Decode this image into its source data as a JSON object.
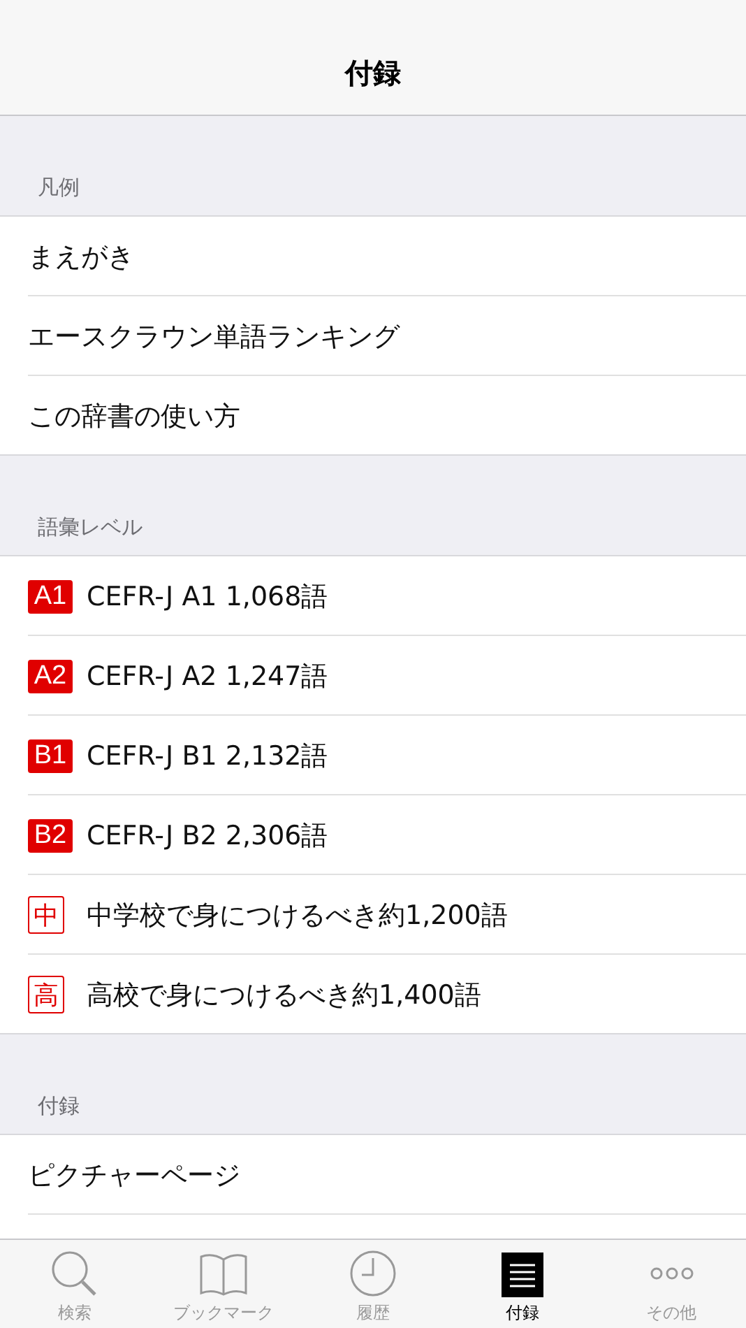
{
  "nav_bar": {
    "title": "付録"
  },
  "sections": [
    {
      "header": "凡例",
      "rows": [
        {
          "label": "まえがき"
        },
        {
          "label": "エースクラウン単語ランキング"
        },
        {
          "label": "この辞書の使い方"
        }
      ]
    },
    {
      "header": "語彙レベル",
      "rows": [
        {
          "badge": "A1",
          "kind": "filled",
          "label": "CEFR-J A1 1,068語"
        },
        {
          "badge": "A2",
          "kind": "filled",
          "label": "CEFR-J A2 1,247語"
        },
        {
          "badge": "B1",
          "kind": "filled",
          "label": "CEFR-J B1 2,132語"
        },
        {
          "badge": "B2",
          "kind": "filled",
          "label": "CEFR-J B2 2,306語"
        },
        {
          "badge": "中",
          "kind": "outline",
          "label": "中学校で身につけるべき約1,200語"
        },
        {
          "badge": "高",
          "kind": "outline",
          "label": "高校で身につけるべき約1,400語"
        }
      ]
    },
    {
      "header": "付録",
      "rows": [
        {
          "label": "ピクチャーページ"
        }
      ]
    }
  ],
  "tab_bar": [
    {
      "label": "検索",
      "kind": "search",
      "selected": false
    },
    {
      "label": "ブックマーク",
      "kind": "book",
      "selected": false
    },
    {
      "label": "履歴",
      "kind": "clock",
      "selected": false
    },
    {
      "label": "付録",
      "kind": "list",
      "selected": true
    },
    {
      "label": "その他",
      "kind": "more",
      "selected": false
    }
  ]
}
